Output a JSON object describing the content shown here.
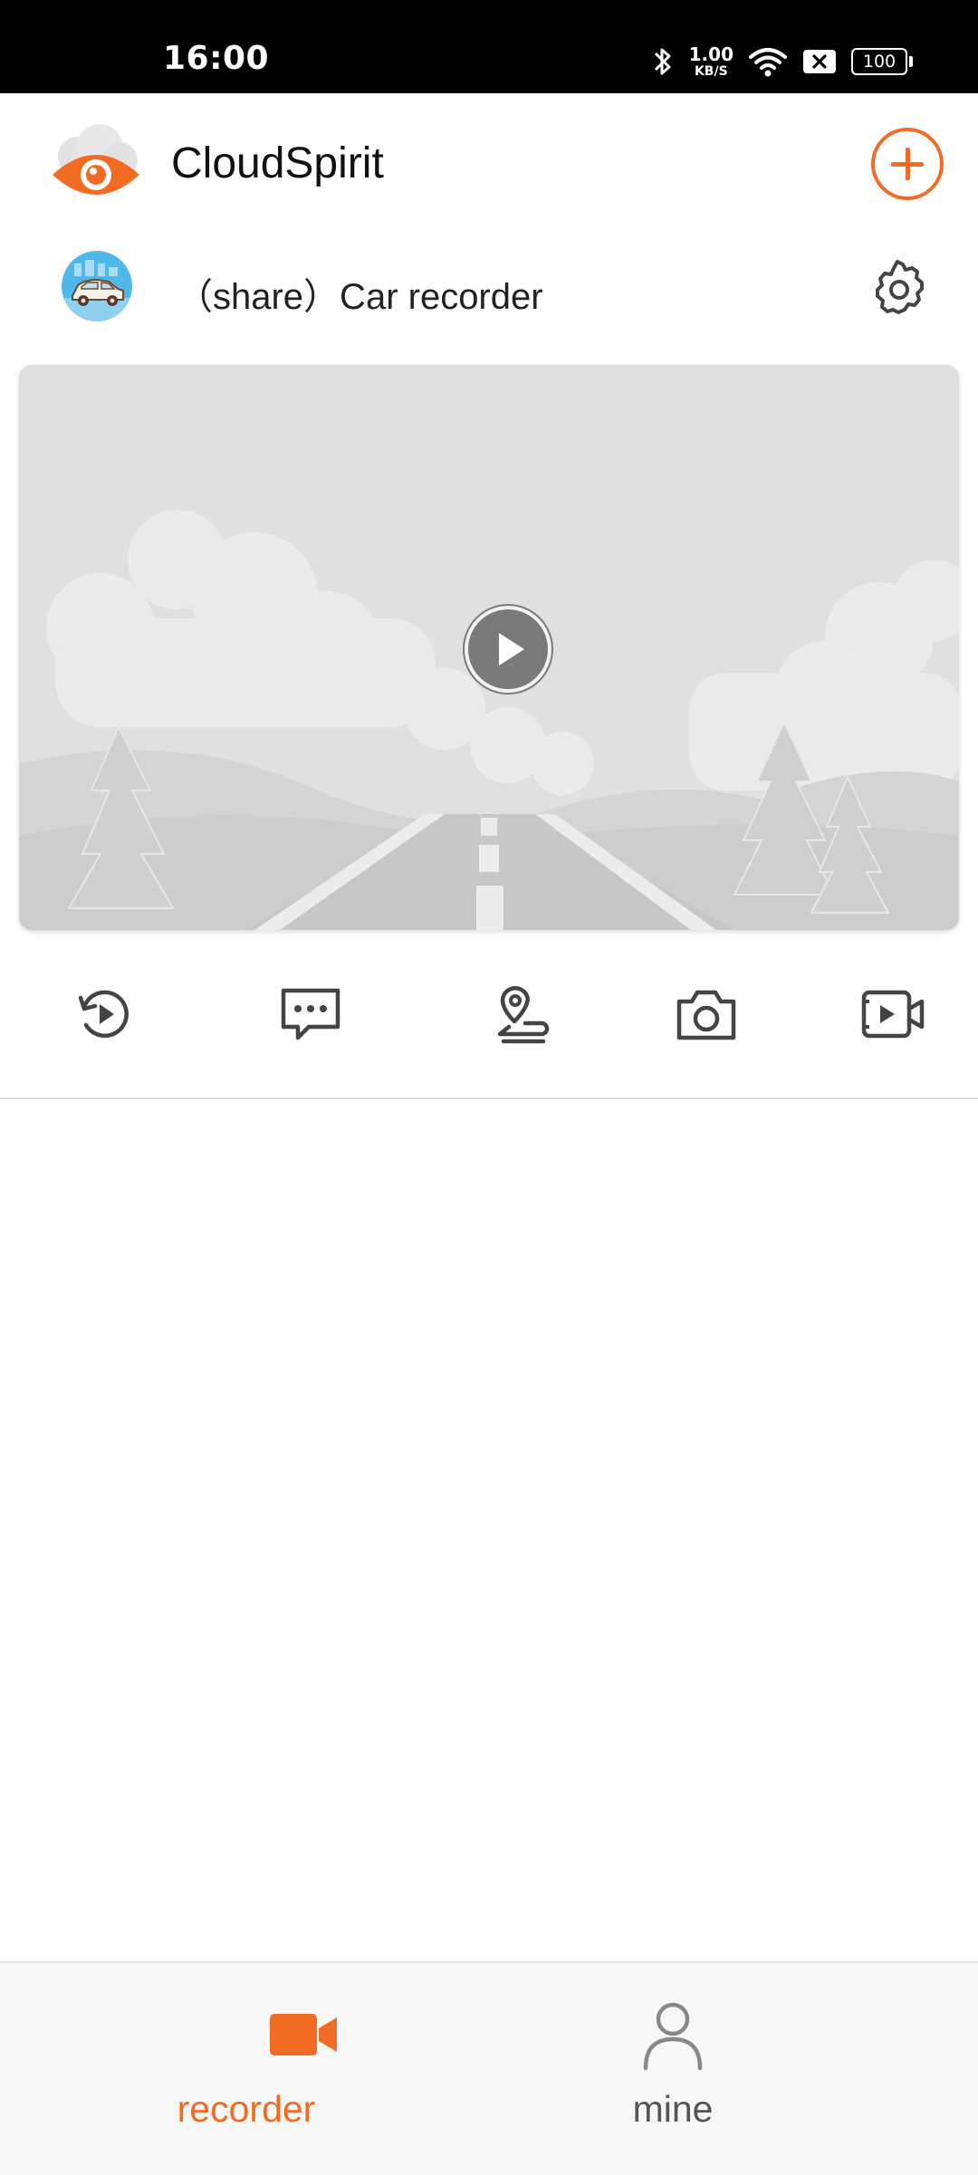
{
  "status_bar": {
    "time": "16:00",
    "net_speed_value": "1.00",
    "net_speed_unit": "KB/S",
    "battery": "100",
    "icons": [
      "bluetooth-icon",
      "wifi-icon",
      "sim-blocked-icon",
      "battery-icon"
    ]
  },
  "app_bar": {
    "title": "CloudSpirit",
    "logo": "cloud-eye-logo",
    "add_icon": "plus-circle-icon"
  },
  "device": {
    "name": "（share）Car recorder",
    "avatar": "car-thumbnail",
    "settings_icon": "gear-icon"
  },
  "player": {
    "placeholder": "road-landscape-illustration",
    "play_icon": "play-icon"
  },
  "toolbar": {
    "items": [
      "playback-history-icon",
      "message-icon",
      "location-track-icon",
      "camera-icon",
      "video-clip-icon"
    ]
  },
  "tabs": [
    {
      "label": "recorder",
      "icon": "video-camera-icon",
      "active": true
    },
    {
      "label": "mine",
      "icon": "person-icon",
      "active": false
    }
  ],
  "colors": {
    "accent": "#f26b22",
    "icon_gray": "#444444",
    "inactive_tab": "#888888",
    "placeholder_bg": "#e0e0e0"
  }
}
